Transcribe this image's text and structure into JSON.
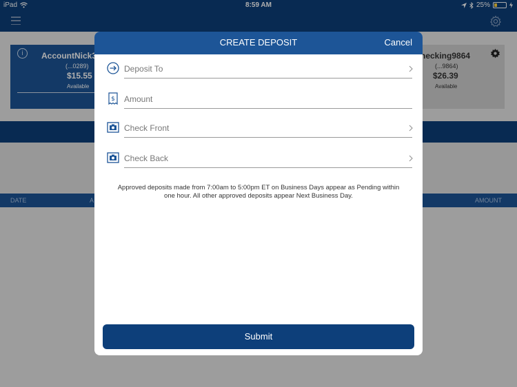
{
  "status_bar": {
    "device": "iPad",
    "time": "8:59 AM",
    "battery": "25%",
    "battery_level": 0.25
  },
  "background": {
    "accounts": [
      {
        "name": "AccountNick3",
        "number": "(...0289)",
        "balance": "$15.55",
        "balance_label": "Available"
      },
      {
        "name": "hecking9864",
        "number": "(...9864)",
        "balance": "$26.39",
        "balance_label": "Available"
      }
    ],
    "table_headers": {
      "date": "DATE",
      "partial": "A",
      "amount": "AMOUNT"
    }
  },
  "modal": {
    "title": "CREATE DEPOSIT",
    "cancel_label": "Cancel",
    "fields": [
      {
        "label": "Deposit To",
        "icon": "arrow-circle-icon",
        "has_chevron": true
      },
      {
        "label": "Amount",
        "icon": "receipt-dollar-icon",
        "has_chevron": false
      },
      {
        "label": "Check Front",
        "icon": "camera-icon",
        "has_chevron": true
      },
      {
        "label": "Check Back",
        "icon": "camera-icon",
        "has_chevron": true
      }
    ],
    "notice": "Approved deposits made from 7:00am to 5:00pm ET on Business Days appear as Pending within one hour. All other approved deposits appear Next Business Day.",
    "submit_label": "Submit"
  },
  "colors": {
    "primary": "#1d5597",
    "dark": "#0d3f7a"
  }
}
